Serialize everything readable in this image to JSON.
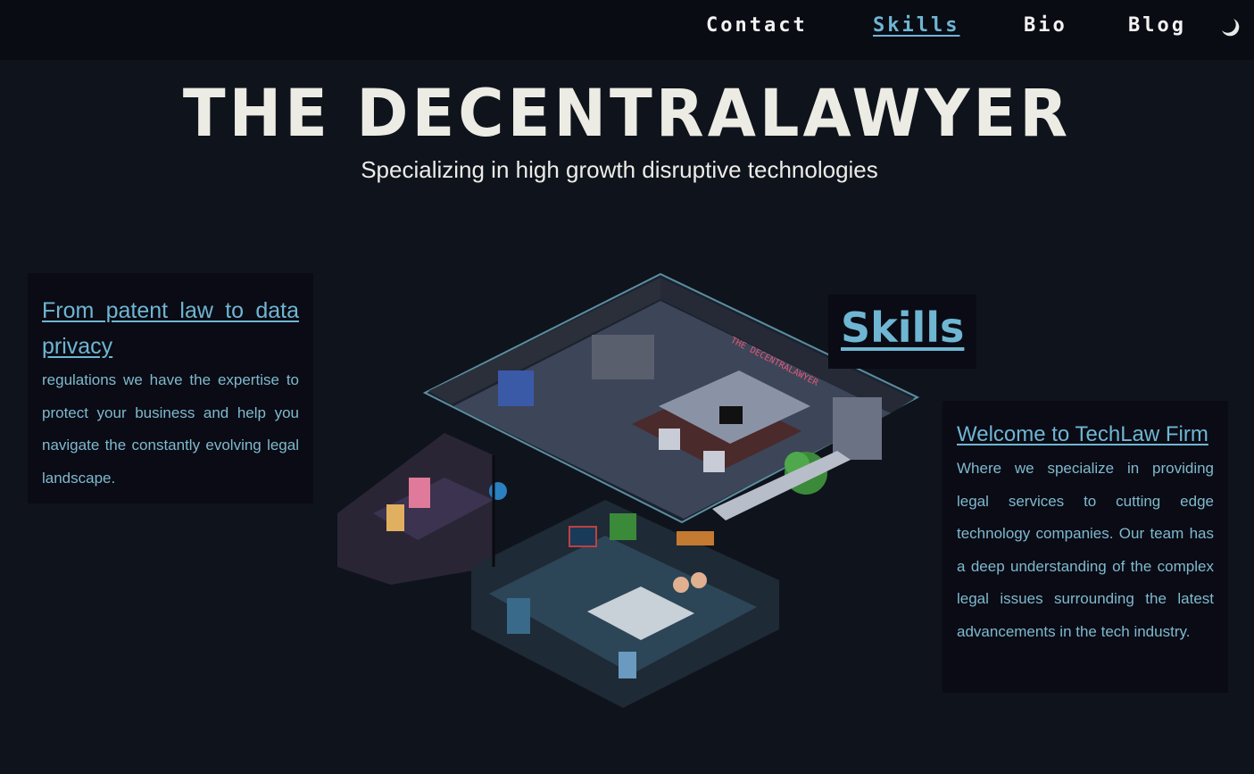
{
  "nav": {
    "items": [
      {
        "label": "Contact",
        "active": false
      },
      {
        "label": "Skills",
        "active": true
      },
      {
        "label": "Bio",
        "active": false
      },
      {
        "label": "Blog",
        "active": false
      }
    ],
    "theme_toggle_icon": "moon-icon"
  },
  "hero": {
    "title": "THE DECENTRALAWYER",
    "subtitle": "Specializing in high growth disruptive technologies"
  },
  "left_card": {
    "heading": "From patent law to data privacy",
    "body": "regulations we have the expertise to protect your business and help you navigate the constantly evolving legal landscape."
  },
  "skills_link": {
    "label": "Skills"
  },
  "right_card": {
    "heading": "Welcome to TechLaw Firm",
    "body": "Where we specialize in providing legal services to cutting edge technology companies. Our team has a deep understanding of the complex legal issues surrounding the latest advancements in the tech industry."
  },
  "illustration": {
    "sign_text": "THE DECENTRALAWYER"
  },
  "colors": {
    "background": "#0f131c",
    "topbar": "#0a0c14",
    "accent": "#6fb6d3",
    "text": "#ecece8"
  }
}
